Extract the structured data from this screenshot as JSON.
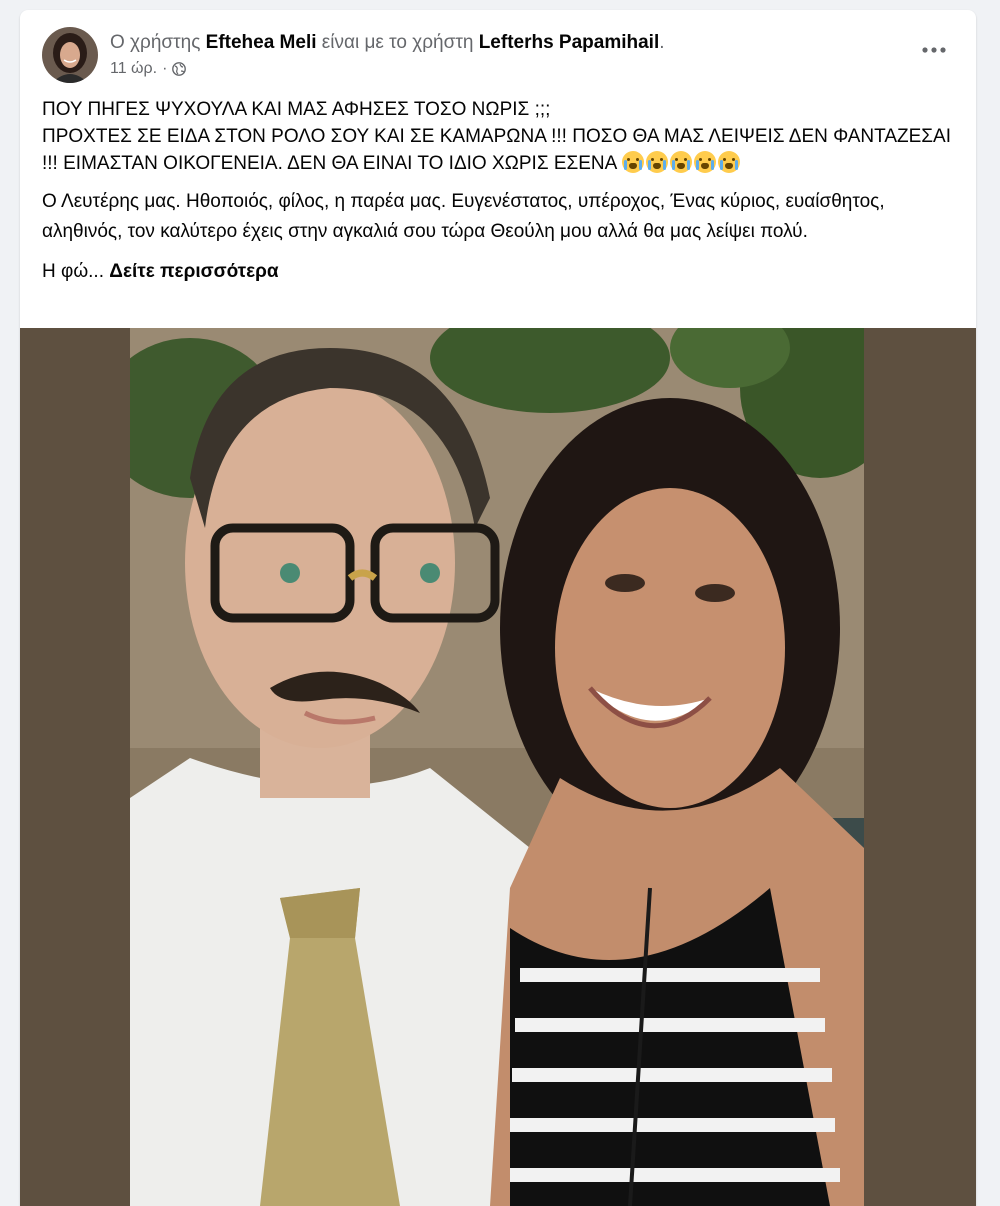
{
  "post": {
    "author_prefix": "Ο χρήστης ",
    "author_name": "Eftehea Meli",
    "with_text": " είναι με το χρήστη ",
    "tagged_name": "Lefterhs Papamihail",
    "tagged_suffix": ".",
    "time": "11 ώρ.",
    "separator": "·",
    "privacy_icon": "globe-icon",
    "more_icon": "more-horizontal-icon",
    "caps_line1": "ΠΟΥ ΠΗΓΕΣ ΨΥΧΟΥΛΑ ΚΑΙ ΜΑΣ ΑΦΗΣΕΣ ΤΟΣΟ ΝΩΡΙΣ ;;;",
    "caps_line2": "ΠΡΟΧΤΕΣ ΣΕ ΕΙΔΑ ΣΤΟΝ ΡΟΛΟ ΣΟΥ ΚΑΙ ΣΕ ΚΑΜΑΡΩΝΑ !!! ΠΟΣΟ ΘΑ ΜΑΣ ΛΕΙΨΕΙΣ ΔΕΝ ΦΑΝΤΑΖΕΣΑΙ !!! ΕΙΜΑΣΤΑΝ ΟΙΚΟΓΕΝΕΙΑ. ΔΕΝ ΘΑ ΕΙΝΑΙ ΤΟ ΙΔΙΟ ΧΩΡΙΣ ΕΣΕΝΑ ",
    "emoji_name": "loudly-crying-face-emoji",
    "emoji_count": 5,
    "paragraph": "Ο Λευτέρης μας. Ηθοποιός, φίλος, η παρέα μας. Ευγενέστατος, υπέροχος, Ένας κύριος, ευαίσθητος, αληθινός, τον καλύτερο έχεις στην αγκαλιά σου τώρα Θεούλη μου αλλά θα μας λείψει πολύ.",
    "truncated": "Η φώ... ",
    "see_more": "Δείτε περισσότερα"
  },
  "colors": {
    "background": "#f0f2f5",
    "card": "#ffffff",
    "primary_text": "#050505",
    "secondary_text": "#65676b",
    "photo_letterbox": "#5e5040"
  }
}
